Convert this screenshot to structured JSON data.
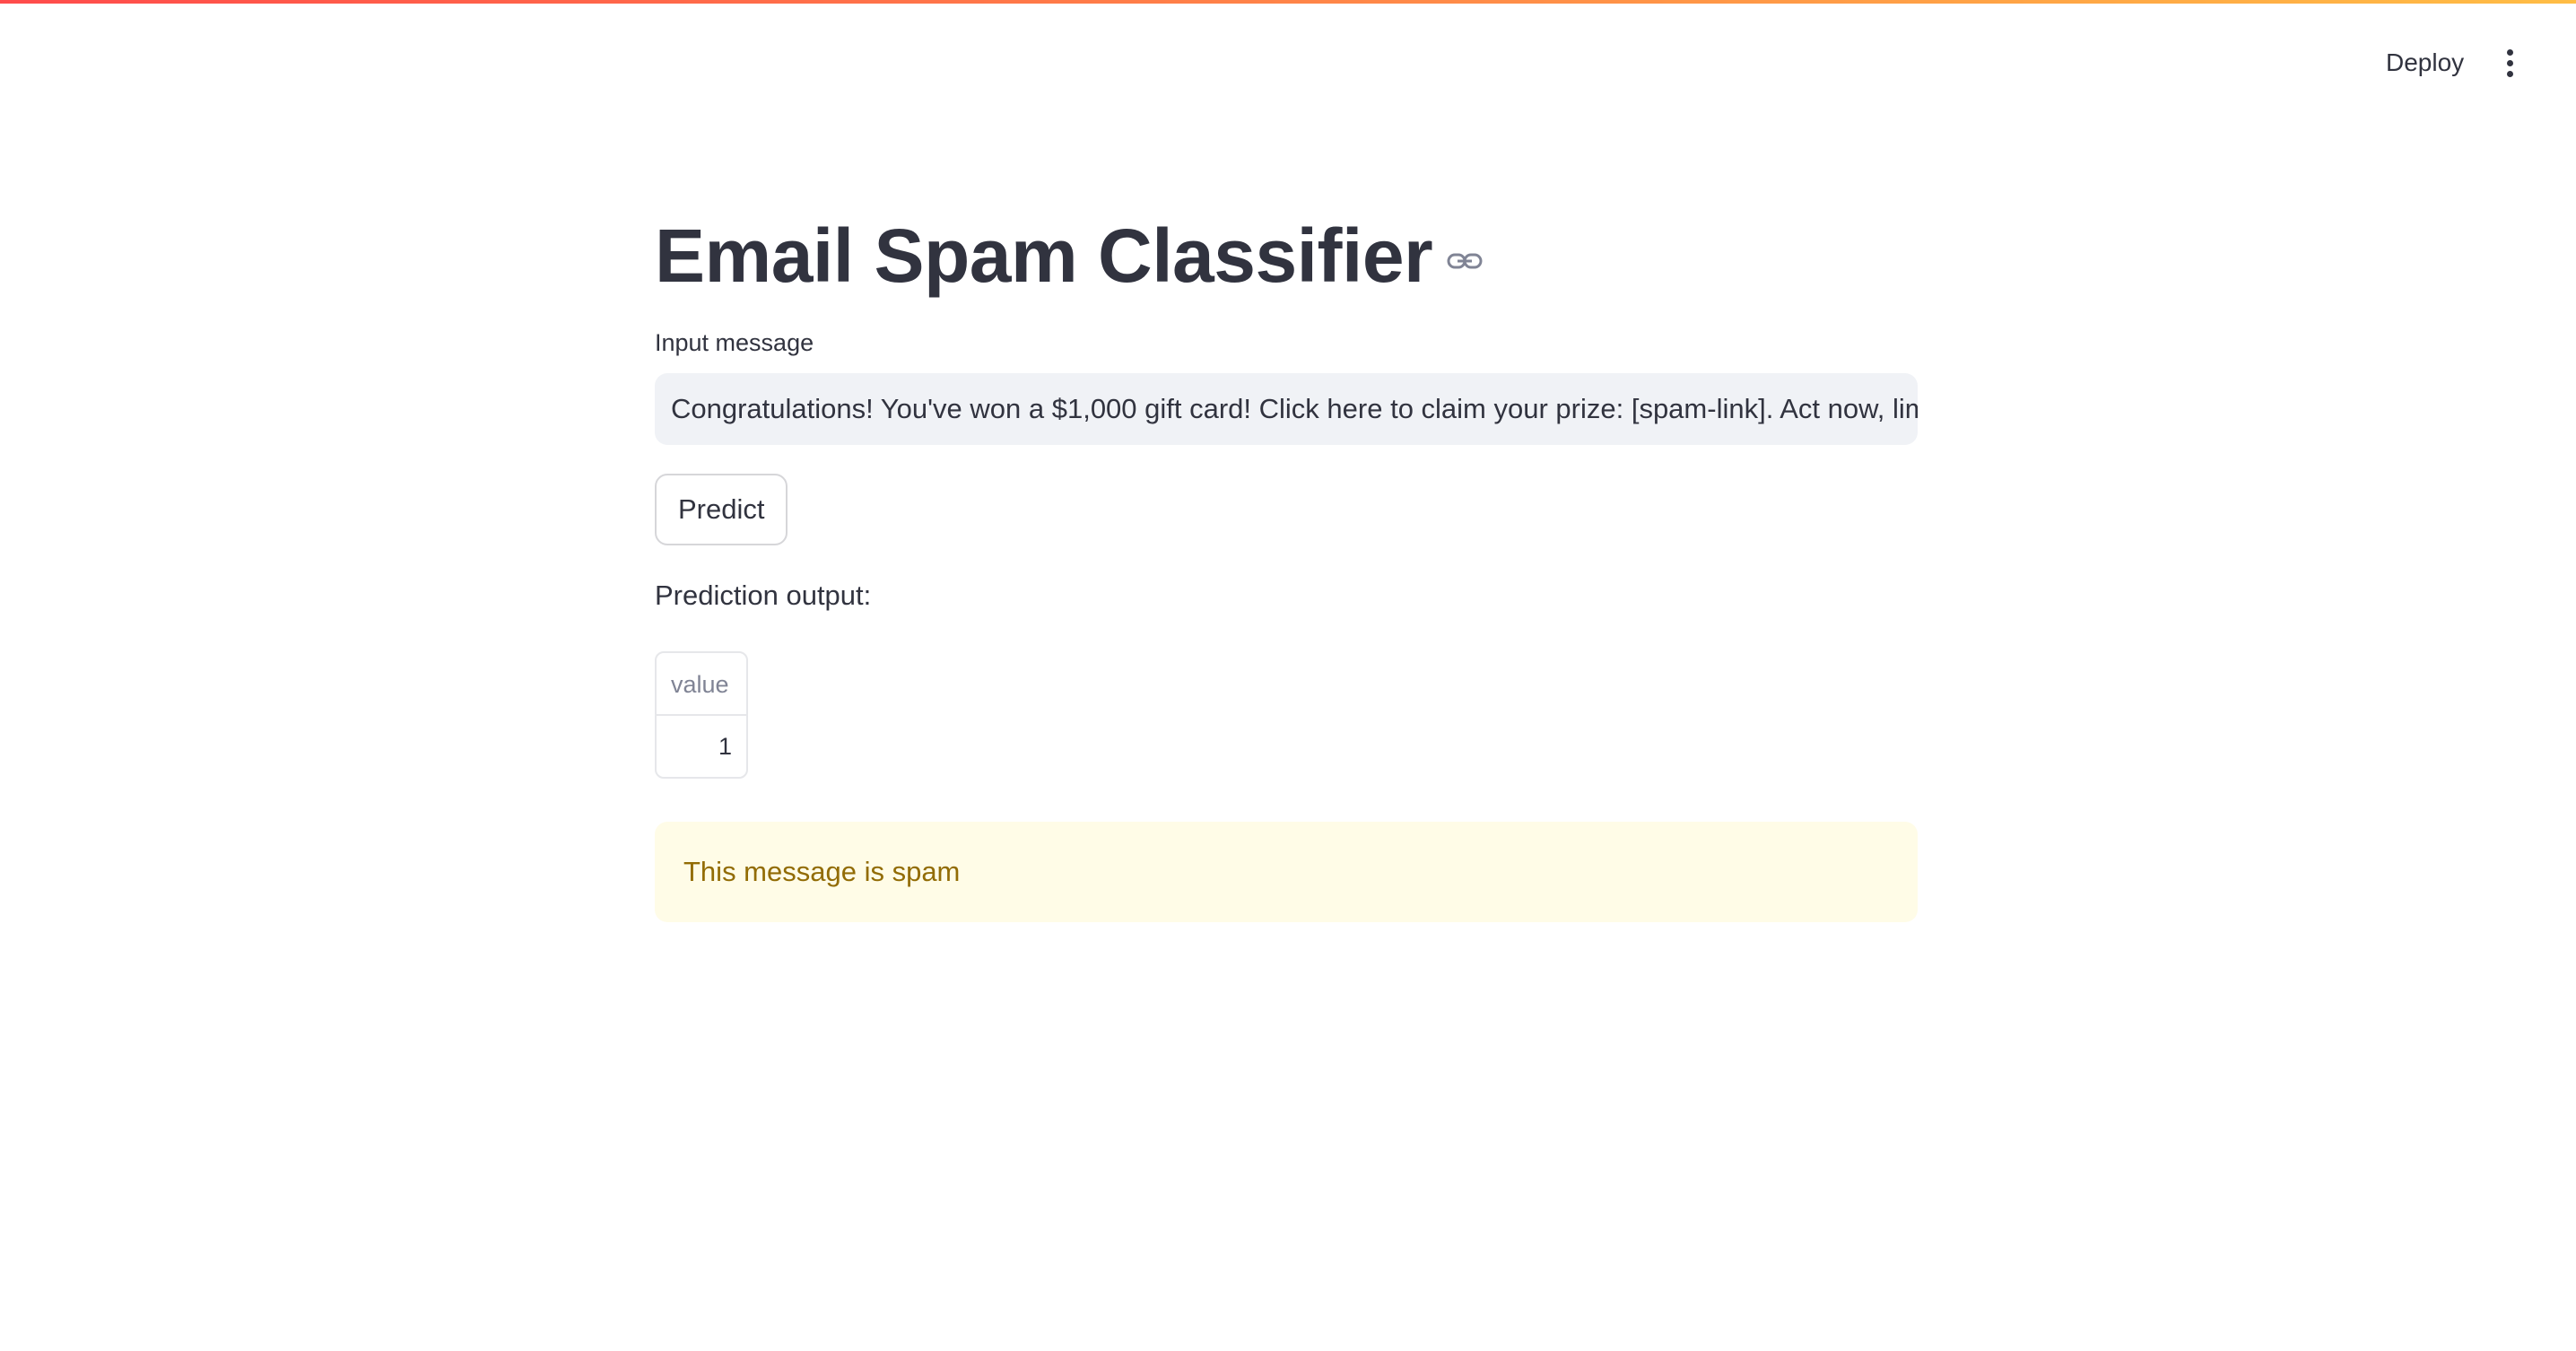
{
  "header": {
    "deploy_label": "Deploy",
    "menu_icon": "vertical-ellipsis-icon"
  },
  "main": {
    "title": "Email Spam Classifier",
    "title_anchor_icon": "link-icon",
    "input_label": "Input message",
    "input_value": "Congratulations! You've won a $1,000 gift card! Click here to claim your prize: [spam-link]. Act now, limit",
    "predict_label": "Predict",
    "prediction_label": "Prediction output:",
    "table": {
      "columns": [
        "value"
      ],
      "rows": [
        [
          "1"
        ]
      ]
    },
    "alert_text": "This message is spam"
  },
  "colors": {
    "accent_gradient_start": "#ff4b4b",
    "accent_gradient_end": "#ffbd45",
    "alert_background": "#fffce7",
    "alert_text": "#926c05",
    "input_background": "#f0f2f6"
  }
}
